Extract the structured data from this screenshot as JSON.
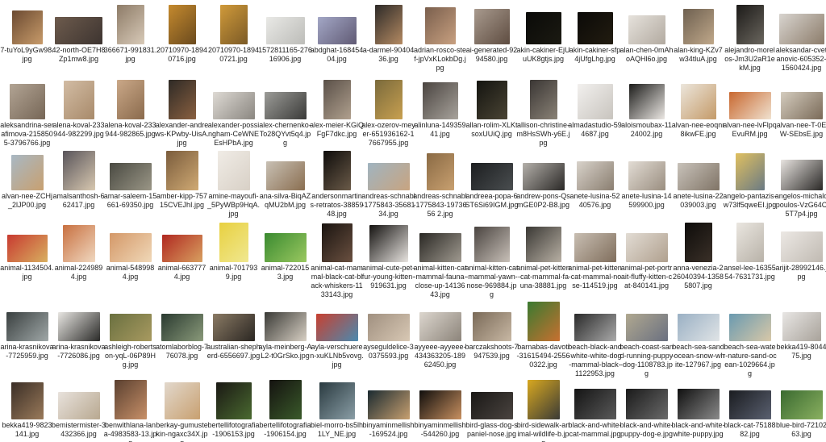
{
  "files": [
    {
      "name": "7-tuYoL9yGw98.jpg",
      "colors": [
        "#6b4a31",
        "#c89b6a"
      ],
      "w": 38,
      "h": 42
    },
    {
      "name": "42-north-OE7H8Zp1mw8.jpg",
      "colors": [
        "#6d5b4d",
        "#3d3430"
      ],
      "w": 59,
      "h": 34
    },
    {
      "name": "366671-991831.jpg",
      "colors": [
        "#8d7b67",
        "#d8cab8"
      ],
      "w": 34,
      "h": 49
    },
    {
      "name": "20710970-18940716.jpg",
      "colors": [
        "#c58a2e",
        "#6a4a1e"
      ],
      "w": 34,
      "h": 49
    },
    {
      "name": "20710970-18940721.jpg",
      "colors": [
        "#d09a3a",
        "#7b5a26"
      ],
      "w": 34,
      "h": 49
    },
    {
      "name": "1572811165-27616906.jpg",
      "colors": [
        "#e9e9e6",
        "#bcbcb8"
      ],
      "w": 48,
      "h": 34
    },
    {
      "name": "abdghat-16845404.jpg",
      "colors": [
        "#a3a7c6",
        "#605a74"
      ],
      "w": 48,
      "h": 34
    },
    {
      "name": "a-darmel-9040436.jpg",
      "colors": [
        "#2d2a28",
        "#b48a62"
      ],
      "w": 34,
      "h": 49
    },
    {
      "name": "adrian-rosco-stef-jpVxKLokbDg.jpg",
      "colors": [
        "#7a5f4d",
        "#c8a080"
      ],
      "w": 38,
      "h": 46
    },
    {
      "name": "ai-generated-9294580.jpg",
      "colors": [
        "#a89a8e",
        "#5e4c40"
      ],
      "w": 44,
      "h": 44
    },
    {
      "name": "akin-cakiner-EjUuUK8gtjs.jpg",
      "colors": [
        "#0a0a08",
        "#1b1a12"
      ],
      "w": 44,
      "h": 40
    },
    {
      "name": "akin-cakiner-sfp4jUfgLhg.jpg",
      "colors": [
        "#0b0a08",
        "#221c10"
      ],
      "w": 44,
      "h": 40
    },
    {
      "name": "alan-chen-0mAhoAQHl6o.jpg",
      "colors": [
        "#e6e2dc",
        "#b2aaa0"
      ],
      "w": 46,
      "h": 36
    },
    {
      "name": "alan-king-KZv7w34tluA.jpg",
      "colors": [
        "#6e6050",
        "#c0a88a"
      ],
      "w": 38,
      "h": 44
    },
    {
      "name": "alejandro-morelos-Jm3U2aR1ekM.jpg",
      "colors": [
        "#1c1a18",
        "#6a665e"
      ],
      "w": 34,
      "h": 49
    },
    {
      "name": "aleksandar-cvetanovic-605352-1560424.jpg",
      "colors": [
        "#d8d4cf",
        "#8c7c6a"
      ],
      "w": 56,
      "h": 38
    },
    {
      "name": "aleksandrina-serafimova-2158505-3796766.jpg",
      "colors": [
        "#b2a494",
        "#766656"
      ],
      "w": 44,
      "h": 44
    },
    {
      "name": "alena-koval-233944-982299.jpg",
      "colors": [
        "#d2bca4",
        "#a88a6a"
      ],
      "w": 38,
      "h": 48
    },
    {
      "name": "alena-koval-233944-982865.jpg",
      "colors": [
        "#caa888",
        "#8a6a4c"
      ],
      "w": 34,
      "h": 49
    },
    {
      "name": "alexander-andrews-KPwby-UisA.jpg",
      "colors": [
        "#2e2a26",
        "#8a6040"
      ],
      "w": 34,
      "h": 49
    },
    {
      "name": "alexander-possingham-CeWNEEsHPbA.jpg",
      "colors": [
        "#dedad4",
        "#8a8680"
      ],
      "w": 52,
      "h": 34
    },
    {
      "name": "alex-chernenko-To28QYvt5q4.jpg",
      "colors": [
        "#9c9c98",
        "#3a3a38"
      ],
      "w": 52,
      "h": 34
    },
    {
      "name": "alex-meier-KGiQFgF7dkc.jpg",
      "colors": [
        "#5a5048",
        "#b0a08e"
      ],
      "w": 34,
      "h": 49
    },
    {
      "name": "alex-ozerov-meyer-651936162-17667955.jpg",
      "colors": [
        "#7a6a3c",
        "#c8a050"
      ],
      "w": 34,
      "h": 49
    },
    {
      "name": "alinluna-14935941.jpg",
      "colors": [
        "#4a4440",
        "#a8a39c"
      ],
      "w": 44,
      "h": 46
    },
    {
      "name": "allan-rolim-XLKtsoxUUiQ.jpg",
      "colors": [
        "#141410",
        "#4a4434"
      ],
      "w": 38,
      "h": 48
    },
    {
      "name": "allison-christine-m8HsSWh-y6E.jpg",
      "colors": [
        "#3a3634",
        "#8a8276"
      ],
      "w": 34,
      "h": 49
    },
    {
      "name": "almadastudio-594687.jpg",
      "colors": [
        "#f2f0ee",
        "#c8c4be"
      ],
      "w": 44,
      "h": 44
    },
    {
      "name": "aloismoubax-1124002.jpg",
      "colors": [
        "#1c1c1a",
        "#ece8e4"
      ],
      "w": 44,
      "h": 44
    },
    {
      "name": "alvan-nee-eoqnr8ikwFE.jpg",
      "colors": [
        "#ece6dc",
        "#c49a68"
      ],
      "w": 44,
      "h": 44
    },
    {
      "name": "alvan-nee-lvFlpqEvuRM.jpg",
      "colors": [
        "#c86830",
        "#f0e2d0"
      ],
      "w": 52,
      "h": 34
    },
    {
      "name": "alvan-nee-T-0EW-SEbsE.jpg",
      "colors": [
        "#d4ccbe",
        "#7a6a58"
      ],
      "w": 52,
      "h": 34
    },
    {
      "name": "alvan-nee-ZCHj_2lJP00.jpg",
      "colors": [
        "#a8b8c4",
        "#c8a070"
      ],
      "w": 40,
      "h": 44
    },
    {
      "name": "amalsanthosh-662417.jpg",
      "colors": [
        "#58545a",
        "#d8c8b0"
      ],
      "w": 40,
      "h": 49
    },
    {
      "name": "amar-saleem-15661-69350.jpg",
      "colors": [
        "#4a4a42",
        "#9a9686"
      ],
      "w": 52,
      "h": 34
    },
    {
      "name": "amber-kipp-75715CVEJhI.jpg",
      "colors": [
        "#7a5c3c",
        "#d0aa74"
      ],
      "w": 40,
      "h": 49
    },
    {
      "name": "amine-mayoufi-_5PyWBp9HqA.jpg",
      "colors": [
        "#f0ece6",
        "#d8d0c6"
      ],
      "w": 40,
      "h": 49
    },
    {
      "name": "ana-silva-BiqAZqMU2bM.jpg",
      "colors": [
        "#c8c0b4",
        "#8a6e50"
      ],
      "w": 48,
      "h": 36
    },
    {
      "name": "andersonmartins-retratos-3885948.jpg",
      "colors": [
        "#0e0c0a",
        "#6a5a48"
      ],
      "w": 34,
      "h": 49
    },
    {
      "name": "andreas-schnabl-1775843-3568134.jpg",
      "colors": [
        "#a0b4c0",
        "#c8a480"
      ],
      "w": 52,
      "h": 34
    },
    {
      "name": "andreas-schnabl-1775843-1973656 2.jpg",
      "colors": [
        "#8a6a44",
        "#c8a070"
      ],
      "w": 34,
      "h": 46
    },
    {
      "name": "andreea-popa-6ST6Si69IGM.jpg",
      "colors": [
        "#1c1e20",
        "#4a4e50"
      ],
      "w": 52,
      "h": 34
    },
    {
      "name": "andrew-pons-QsmGE0P2-B8.jpg",
      "colors": [
        "#b4b0aa",
        "#2a2826"
      ],
      "w": 52,
      "h": 34
    },
    {
      "name": "anete-lusina-5240576.jpg",
      "colors": [
        "#d8d2ca",
        "#8a7e70"
      ],
      "w": 46,
      "h": 36
    },
    {
      "name": "anete-lusina-14599900.jpg",
      "colors": [
        "#e2dcd4",
        "#9a8e80"
      ],
      "w": 46,
      "h": 36
    },
    {
      "name": "anete-lusina-22039003.jpg",
      "colors": [
        "#c8c2ba",
        "#807466"
      ],
      "w": 52,
      "h": 34
    },
    {
      "name": "angelo-pantazis-w73lf5qweEI.jpg",
      "colors": [
        "#e0c060",
        "#6a7a84"
      ],
      "w": 36,
      "h": 46
    },
    {
      "name": "angelos-michalopoulos-VzG64C5T7p4.jpg",
      "colors": [
        "#e8e4e0",
        "#2a2826"
      ],
      "w": 52,
      "h": 38
    },
    {
      "name": "animal-1134504.jpg",
      "colors": [
        "#c83a30",
        "#d8b060"
      ],
      "w": 50,
      "h": 34
    },
    {
      "name": "animal-2249894.jpg",
      "colors": [
        "#c87040",
        "#f0d8c0"
      ],
      "w": 40,
      "h": 46
    },
    {
      "name": "animal-5489984.jpg",
      "colors": [
        "#d49868",
        "#f0d8b8"
      ],
      "w": 52,
      "h": 36
    },
    {
      "name": "animal-6637774.jpg",
      "colors": [
        "#b02820",
        "#d8a060"
      ],
      "w": 50,
      "h": 34
    },
    {
      "name": "animal-7017939.jpg",
      "colors": [
        "#e8d040",
        "#f0e890"
      ],
      "w": 36,
      "h": 49
    },
    {
      "name": "animal-7220153.jpg",
      "colors": [
        "#3a8a30",
        "#9ac860"
      ],
      "w": 52,
      "h": 36
    },
    {
      "name": "animal-cat-mammal-black-cat-black-whiskers-1133143.jpg",
      "colors": [
        "#1a1410",
        "#6a5040"
      ],
      "w": 38,
      "h": 48
    },
    {
      "name": "animal-cute-pet-fur-young-kitten-919631.jpg",
      "colors": [
        "#141210",
        "#e8e4e0"
      ],
      "w": 48,
      "h": 46
    },
    {
      "name": "animal-kitten-cat-mammal-fauna-close-up-1413643.jpg",
      "colors": [
        "#2a2824",
        "#a09a90"
      ],
      "w": 52,
      "h": 36
    },
    {
      "name": "animal-kitten-cat-mammal-yawn-nose-969884.jpg",
      "colors": [
        "#4a4440",
        "#c8c0b8"
      ],
      "w": 44,
      "h": 44
    },
    {
      "name": "animal-pet-kitten-cat-mammal-fauna-38881.jpg",
      "colors": [
        "#3a3834",
        "#b8b0a4"
      ],
      "w": 44,
      "h": 44
    },
    {
      "name": "animal-pet-kitten-cat-mammal-nose-114519.jpg",
      "colors": [
        "#c8beb2",
        "#806e5c"
      ],
      "w": 52,
      "h": 36
    },
    {
      "name": "animal-pet-portrait-fluffy-kitten-cat-840141.jpg",
      "colors": [
        "#e2dcd4",
        "#b0a08e"
      ],
      "w": 52,
      "h": 36
    },
    {
      "name": "anna-venezia-226040394-13585807.jpg",
      "colors": [
        "#0e0c0a",
        "#3a3028"
      ],
      "w": 34,
      "h": 49
    },
    {
      "name": "ansel-lee-1635554-7631731.jpg",
      "colors": [
        "#eae6e0",
        "#b8b2a8"
      ],
      "w": 34,
      "h": 49
    },
    {
      "name": "arijit-28992146.jpg",
      "colors": [
        "#ece8e4",
        "#c0bab2"
      ],
      "w": 52,
      "h": 38
    },
    {
      "name": "arina-krasnikova-7725959.jpg",
      "colors": [
        "#3a4040",
        "#a0a8a8"
      ],
      "w": 52,
      "h": 36
    },
    {
      "name": "arina-krasnikova-7726086.jpg",
      "colors": [
        "#e8e6e2",
        "#2a2a28"
      ],
      "w": 52,
      "h": 36
    },
    {
      "name": "ashleigh-robertson-yqL-06P89Hg.jpg",
      "colors": [
        "#6a7040",
        "#a89a60"
      ],
      "w": 52,
      "h": 34
    },
    {
      "name": "atomlaborblog-776078.jpg",
      "colors": [
        "#2a3a30",
        "#8a9a7a"
      ],
      "w": 52,
      "h": 34
    },
    {
      "name": "australian-shepherd-6556697.jpg",
      "colors": [
        "#8a7a64",
        "#2a2622"
      ],
      "w": 52,
      "h": 34
    },
    {
      "name": "ayla-meinberg-AL2-t0GrSko.jpg",
      "colors": [
        "#3a3a36",
        "#d8d0c4"
      ],
      "w": 52,
      "h": 36
    },
    {
      "name": "ayla-verschueren-xuKLNb5vovg.jpg",
      "colors": [
        "#c84030",
        "#4a8ab0"
      ],
      "w": 52,
      "h": 34
    },
    {
      "name": "ayseguldelice-30375593.jpg",
      "colors": [
        "#a09080",
        "#d8c8b4"
      ],
      "w": 52,
      "h": 34
    },
    {
      "name": "ayyeee-ayyeee-434363205-18962450.jpg",
      "colors": [
        "#dcd6ce",
        "#8c847a"
      ],
      "w": 52,
      "h": 36
    },
    {
      "name": "barczakshoots-7947539.jpg",
      "colors": [
        "#7a6a58",
        "#c8b8a4"
      ],
      "w": 48,
      "h": 36
    },
    {
      "name": "barnabas-davoti-31615494-25560322.jpg",
      "colors": [
        "#3a7a30",
        "#c87030"
      ],
      "w": 40,
      "h": 49
    },
    {
      "name": "beach-black-and-white-white-dog-mammal-black-1122953.jpg",
      "colors": [
        "#2a2a2a",
        "#aaaaaa"
      ],
      "w": 52,
      "h": 34
    },
    {
      "name": "beach-coast-sand-running-puppy-dog-1108783.jpg",
      "colors": [
        "#b0a890",
        "#6a7080"
      ],
      "w": 52,
      "h": 34
    },
    {
      "name": "beach-sea-sand-ocean-snow-white-127967.jpg",
      "colors": [
        "#9ab0c4",
        "#e0e4e6"
      ],
      "w": 52,
      "h": 34
    },
    {
      "name": "beach-sea-water-nature-sand-ocean-1029664.jpg",
      "colors": [
        "#6a9ab0",
        "#d8c8a8"
      ],
      "w": 52,
      "h": 34
    },
    {
      "name": "bekka419-804475.jpg",
      "colors": [
        "#e8e6e4",
        "#a8a29a"
      ],
      "w": 48,
      "h": 36
    },
    {
      "name": "bekka419-9823141.jpg",
      "colors": [
        "#3a2e26",
        "#9a7a5a"
      ],
      "w": 40,
      "h": 46
    },
    {
      "name": "bemistermister-3432366.jpg",
      "colors": [
        "#e8e2dc",
        "#b8a890"
      ],
      "w": 52,
      "h": 34
    },
    {
      "name": "benwithlana-lana-4983583-13.jpg",
      "colors": [
        "#5a4030",
        "#c89068"
      ],
      "w": 40,
      "h": 49
    },
    {
      "name": "berkay-gumustekin-ngaxc34X.jpg",
      "colors": [
        "#e2d8cc",
        "#c8a070"
      ],
      "w": 44,
      "h": 46
    },
    {
      "name": "bertellifotografia-1906153.jpg",
      "colors": [
        "#1a1814",
        "#4a6a30"
      ],
      "w": 44,
      "h": 46
    },
    {
      "name": "bertellifotografia-1906154.jpg",
      "colors": [
        "#141210",
        "#3a5a2a"
      ],
      "w": 40,
      "h": 49
    },
    {
      "name": "biel-morro-bs5lh1LY_NE.jpg",
      "colors": [
        "#2a3a40",
        "#8a9ea6"
      ],
      "w": 44,
      "h": 46
    },
    {
      "name": "binyaminmellish-169524.jpg",
      "colors": [
        "#1a2a30",
        "#c8a070"
      ],
      "w": 52,
      "h": 36
    },
    {
      "name": "binyaminmellish-544260.jpg",
      "colors": [
        "#100e0c",
        "#c89060"
      ],
      "w": 52,
      "h": 36
    },
    {
      "name": "bird-glass-dog-spaniel-nose.jpg",
      "colors": [
        "#1a1816",
        "#4a4440"
      ],
      "w": 52,
      "h": 34
    },
    {
      "name": "bird-sidewalk-animal-wildlife-b.jpg",
      "colors": [
        "#d8a820",
        "#3a3a36"
      ],
      "w": 40,
      "h": 49
    },
    {
      "name": "black-and-white-cat-mammal.jpg",
      "colors": [
        "#141414",
        "#5a5a5a"
      ],
      "w": 52,
      "h": 38
    },
    {
      "name": "black-and-white-puppy-dog-e.jpg",
      "colors": [
        "#1a1a1a",
        "#6a6a6a"
      ],
      "w": 52,
      "h": 38
    },
    {
      "name": "black-and-white-white-puppy.jpg",
      "colors": [
        "#101010",
        "#8a8a8a"
      ],
      "w": 52,
      "h": 38
    },
    {
      "name": "black-cat-7518882.jpg",
      "colors": [
        "#1a1c20",
        "#5a6070"
      ],
      "w": 52,
      "h": 36
    },
    {
      "name": "blue-bird-7210263.jpg",
      "colors": [
        "#3a6a30",
        "#8ab060"
      ],
      "w": 52,
      "h": 36
    }
  ]
}
